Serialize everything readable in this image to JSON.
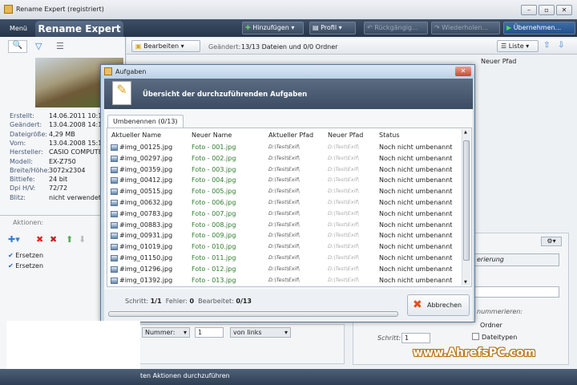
{
  "window": {
    "title": "Rename Expert (registriert)",
    "min": "–",
    "max": "▫",
    "close": "✕"
  },
  "header": {
    "menu": "Menü",
    "app_tab": "Rename Expert",
    "add": "Hinzufügen",
    "profile": "Profil",
    "undo": "Rückgängig...",
    "redo": "Wiederholen...",
    "apply": "Übernehmen..."
  },
  "toolbar": {
    "edit": "Bearbeiten",
    "changed_label": "Geändert:",
    "changed_value": "13/13 Dateien und 0/0 Ordner",
    "view": "Liste",
    "behind_col": "Neuer Pfad"
  },
  "info": [
    {
      "k": "Erstellt:",
      "v": "14.06.2011 10:11:3"
    },
    {
      "k": "Geändert:",
      "v": "13.04.2008 14:11:3"
    },
    {
      "k": "Dateigröße:",
      "v": "4,29 MB"
    },
    {
      "k": "Vom:",
      "v": "13.04.2008 15:11:2"
    },
    {
      "k": "Hersteller:",
      "v": "CASIO COMPUTE"
    },
    {
      "k": "Modell:",
      "v": "EX-Z750"
    },
    {
      "k": "Breite/Höhe:",
      "v": "3072x2304"
    },
    {
      "k": "Bittiefe:",
      "v": "24 bit"
    },
    {
      "k": "Dpi H/V:",
      "v": "72/72"
    },
    {
      "k": "Blitz:",
      "v": "nicht verwendet"
    }
  ],
  "actions": {
    "title": "Aktionen:",
    "items": [
      "Ersetzen",
      "Ersetzen"
    ]
  },
  "dialog": {
    "title": "Aufgaben",
    "banner": "Übersicht der durchzuführenden Aufgaben",
    "tab": "Umbenennen (0/13)",
    "columns": [
      "Aktueller Name",
      "Neuer Name",
      "Aktueller Pfad",
      "Neuer Pfad",
      "Status"
    ],
    "rows": [
      [
        "#img_00125.jpg",
        "Foto - 001.jpg",
        "D:\\Test\\Exif\\",
        "D:\\Test\\Exif\\",
        "Noch nicht umbenannt"
      ],
      [
        "#img_00297.jpg",
        "Foto - 002.jpg",
        "D:\\Test\\Exif\\",
        "D:\\Test\\Exif\\",
        "Noch nicht umbenannt"
      ],
      [
        "#img_00359.jpg",
        "Foto - 003.jpg",
        "D:\\Test\\Exif\\",
        "D:\\Test\\Exif\\",
        "Noch nicht umbenannt"
      ],
      [
        "#img_00412.jpg",
        "Foto - 004.jpg",
        "D:\\Test\\Exif\\",
        "D:\\Test\\Exif\\",
        "Noch nicht umbenannt"
      ],
      [
        "#img_00515.jpg",
        "Foto - 005.jpg",
        "D:\\Test\\Exif\\",
        "D:\\Test\\Exif\\",
        "Noch nicht umbenannt"
      ],
      [
        "#img_00632.jpg",
        "Foto - 006.jpg",
        "D:\\Test\\Exif\\",
        "D:\\Test\\Exif\\",
        "Noch nicht umbenannt"
      ],
      [
        "#img_00783.jpg",
        "Foto - 007.jpg",
        "D:\\Test\\Exif\\",
        "D:\\Test\\Exif\\",
        "Noch nicht umbenannt"
      ],
      [
        "#img_00883.jpg",
        "Foto - 008.jpg",
        "D:\\Test\\Exif\\",
        "D:\\Test\\Exif\\",
        "Noch nicht umbenannt"
      ],
      [
        "#img_00931.jpg",
        "Foto - 009.jpg",
        "D:\\Test\\Exif\\",
        "D:\\Test\\Exif\\",
        "Noch nicht umbenannt"
      ],
      [
        "#img_01019.jpg",
        "Foto - 010.jpg",
        "D:\\Test\\Exif\\",
        "D:\\Test\\Exif\\",
        "Noch nicht umbenannt"
      ],
      [
        "#img_01150.jpg",
        "Foto - 011.jpg",
        "D:\\Test\\Exif\\",
        "D:\\Test\\Exif\\",
        "Noch nicht umbenannt"
      ],
      [
        "#img_01296.jpg",
        "Foto - 012.jpg",
        "D:\\Test\\Exif\\",
        "D:\\Test\\Exif\\",
        "Noch nicht umbenannt"
      ],
      [
        "#img_01392.jpg",
        "Foto - 013.jpg",
        "D:\\Test\\Exif\\",
        "D:\\Test\\Exif\\",
        "Noch nicht umbenannt"
      ]
    ],
    "step_label": "Schritt:",
    "step_value": "1/1",
    "errors_label": "Fehler:",
    "errors_value": "0",
    "done_label": "Bearbeitet:",
    "done_value": "0/13",
    "progress_percent": 0,
    "cancel": "Abbrechen"
  },
  "lower": {
    "number_select": "Nummer:",
    "number_value": "1",
    "from_select": "von links",
    "step_label": "Schritt:",
    "step_value": "1",
    "numbering_title": "erierung",
    "renumber_label": "nummerieren:",
    "folder_label": "Ordner",
    "filetypes_label": "Dateitypen"
  },
  "statusbar": {
    "text": "ten Aktionen durchzuführen"
  },
  "watermark": "www.AhrefsPC.com"
}
